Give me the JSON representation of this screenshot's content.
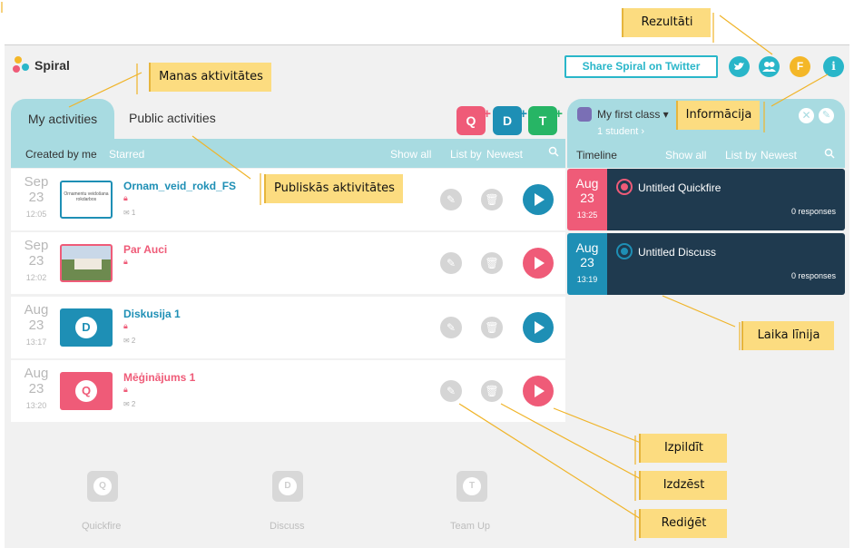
{
  "app": {
    "logo_text": "Spiral"
  },
  "header": {
    "twitter_button": "Share Spiral on Twitter",
    "account_initial": "F",
    "info_glyph": "i"
  },
  "tabs": {
    "my": "My activities",
    "public": "Public activities"
  },
  "add_buttons": [
    {
      "letter": "Q",
      "color": "#ef5b78"
    },
    {
      "letter": "D",
      "color": "#1e8fb5"
    },
    {
      "letter": "T",
      "color": "#27b565"
    }
  ],
  "filters": {
    "created_by_me": "Created by me",
    "starred": "Starred",
    "show_all": "Show all",
    "list_by": "List by",
    "newest": "Newest"
  },
  "activities": [
    {
      "month": "Sep",
      "day": "23",
      "time": "12:05",
      "title": "Ornam_veid_rokd_FS",
      "meta": "1",
      "thumb_text": "Ornamentu veidošana rokdarbos",
      "color": "#1e8fb5"
    },
    {
      "month": "Sep",
      "day": "23",
      "time": "12:02",
      "title": "Par Auci",
      "meta": "",
      "thumb_text": "",
      "color": "#ef5b78"
    },
    {
      "month": "Aug",
      "day": "23",
      "time": "13:17",
      "title": "Diskusija 1",
      "meta": "2",
      "thumb_text": "D",
      "color": "#1e8fb5"
    },
    {
      "month": "Aug",
      "day": "23",
      "time": "13:20",
      "title": "Mēģinājums 1",
      "meta": "2",
      "thumb_text": "Q",
      "color": "#ef5b78"
    }
  ],
  "right_panel": {
    "class_name": "My first class ▾",
    "students": "1 student ›",
    "timeline": "Timeline",
    "show_all": "Show all",
    "list_by": "List by",
    "newest": "Newest",
    "items": [
      {
        "month": "Aug",
        "day": "23",
        "time": "13:25",
        "title": "Untitled Quickfire",
        "responses": "0 responses",
        "color": "#ef5b78"
      },
      {
        "month": "Aug",
        "day": "23",
        "time": "13:19",
        "title": "Untitled Discuss",
        "responses": "0 responses",
        "color": "#1e8fb5"
      }
    ]
  },
  "bottom_types": [
    {
      "letter": "Q",
      "label": "Quickfire"
    },
    {
      "letter": "D",
      "label": "Discuss"
    },
    {
      "letter": "T",
      "label": "Team Up"
    }
  ],
  "annotations": {
    "rezultati": "Rezultāti",
    "manas": "Manas aktivitātes",
    "informacija": "Informācija",
    "publiskas": "Publiskās aktivitātes",
    "laika_linija": "Laika līnija",
    "izpildit": "Izpildīt",
    "izdzest": "Izdzēst",
    "rediget": "Rediģēt"
  },
  "colors": {
    "accent_teal": "#a8dbe1",
    "quickfire": "#ef5b78",
    "discuss": "#1e8fb5",
    "teamup": "#27b565",
    "timeline_dark": "#1f3a4f",
    "callout": "#fcdc80"
  }
}
